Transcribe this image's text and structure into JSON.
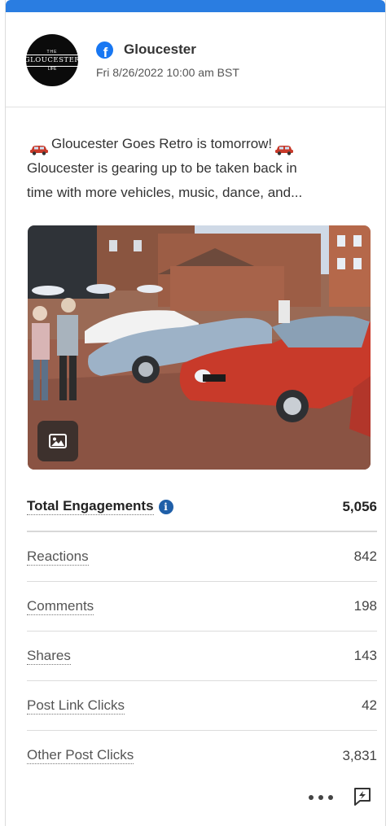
{
  "colors": {
    "accent": "#2a7de1",
    "facebook": "#1877f2",
    "info": "#1f5fa8",
    "car_red": "#c83a2a"
  },
  "post": {
    "page_name": "Gloucester",
    "network_icon": "facebook-icon",
    "date": "Fri 8/26/2022 10:00 am BST",
    "avatar_lines": [
      "THE",
      "GLOUCESTER",
      "LIFE"
    ],
    "text_line1": "Gloucester Goes Retro is tomorrow!",
    "text_line2": "Gloucester is gearing up to be taken back in",
    "text_line3": "time with more vehicles, music, dance, and..."
  },
  "metrics": {
    "total": {
      "label": "Total Engagements",
      "value": "5,056"
    },
    "items": [
      {
        "label": "Reactions",
        "value": "842"
      },
      {
        "label": "Comments",
        "value": "198"
      },
      {
        "label": "Shares",
        "value": "143"
      },
      {
        "label": "Post Link Clicks",
        "value": "42"
      },
      {
        "label": "Other Post Clicks",
        "value": "3,831"
      }
    ]
  },
  "footer": {
    "more_icon": "ellipsis-icon",
    "boost_icon": "boost-icon"
  }
}
